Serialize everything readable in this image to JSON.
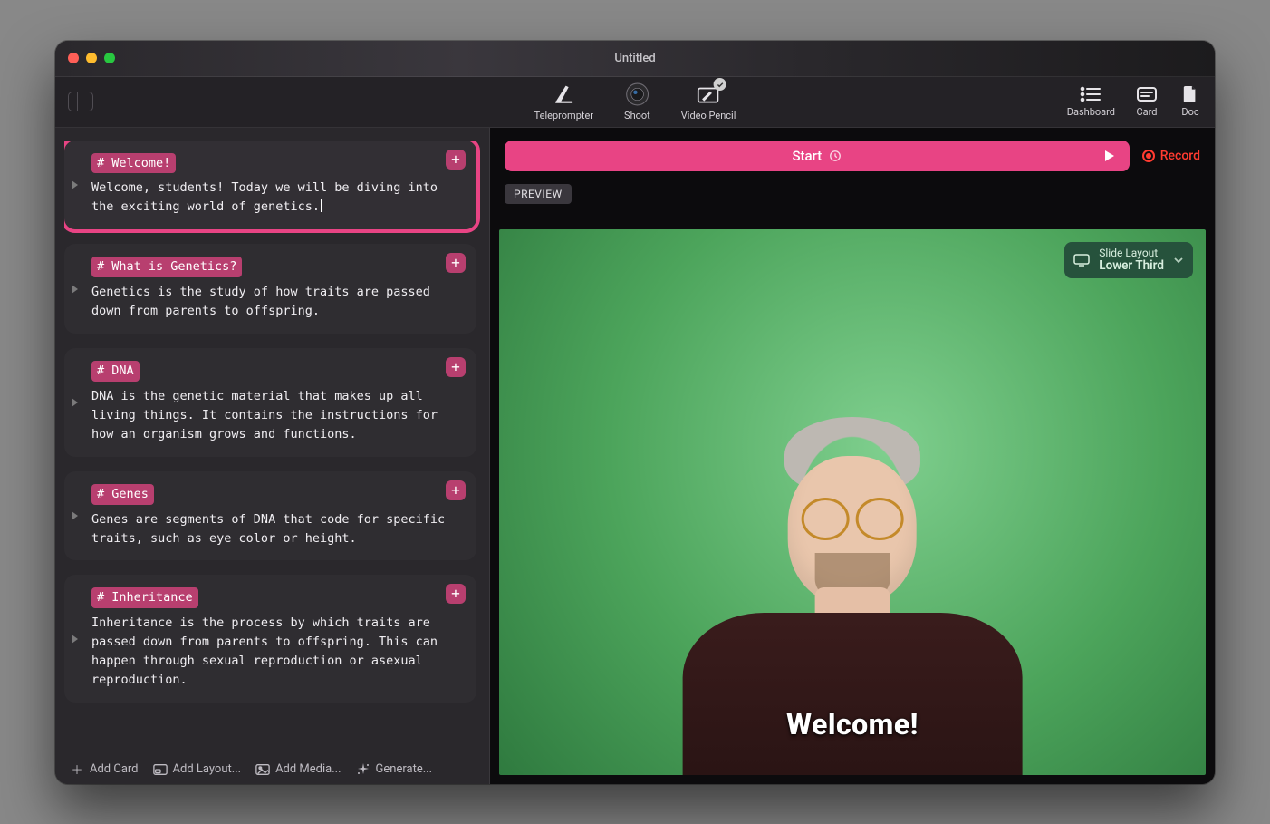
{
  "window": {
    "title": "Untitled"
  },
  "toolbar": {
    "center": [
      {
        "label": "Teleprompter"
      },
      {
        "label": "Shoot"
      },
      {
        "label": "Video Pencil"
      }
    ],
    "right": [
      {
        "label": "Dashboard"
      },
      {
        "label": "Card"
      },
      {
        "label": "Doc"
      }
    ]
  },
  "cards": [
    {
      "heading": "# Welcome!",
      "body": "Welcome, students! Today we will be diving into the exciting world of genetics.",
      "selected": true,
      "showCursor": true
    },
    {
      "heading": "# What is Genetics?",
      "body": "Genetics is the study of how traits are passed down from parents to offspring.",
      "selected": false
    },
    {
      "heading": "# DNA",
      "body": "DNA is the genetic material that makes up all living things. It contains the instructions for how an organism grows and functions.",
      "selected": false
    },
    {
      "heading": "# Genes",
      "body": "Genes are segments of DNA that code for specific traits, such as eye color or height.",
      "selected": false
    },
    {
      "heading": "# Inheritance",
      "body": "Inheritance is the process by which traits are passed down from parents to offspring. This can happen through sexual reproduction or asexual reproduction.",
      "selected": false
    }
  ],
  "leftFooter": {
    "addCard": "Add Card",
    "addLayout": "Add Layout...",
    "addMedia": "Add Media...",
    "generate": "Generate..."
  },
  "rightTop": {
    "start": "Start",
    "record": "Record",
    "preview": "PREVIEW"
  },
  "slideLayout": {
    "caption": "Slide Layout",
    "value": "Lower Third"
  },
  "lowerThirdText": "Welcome!"
}
